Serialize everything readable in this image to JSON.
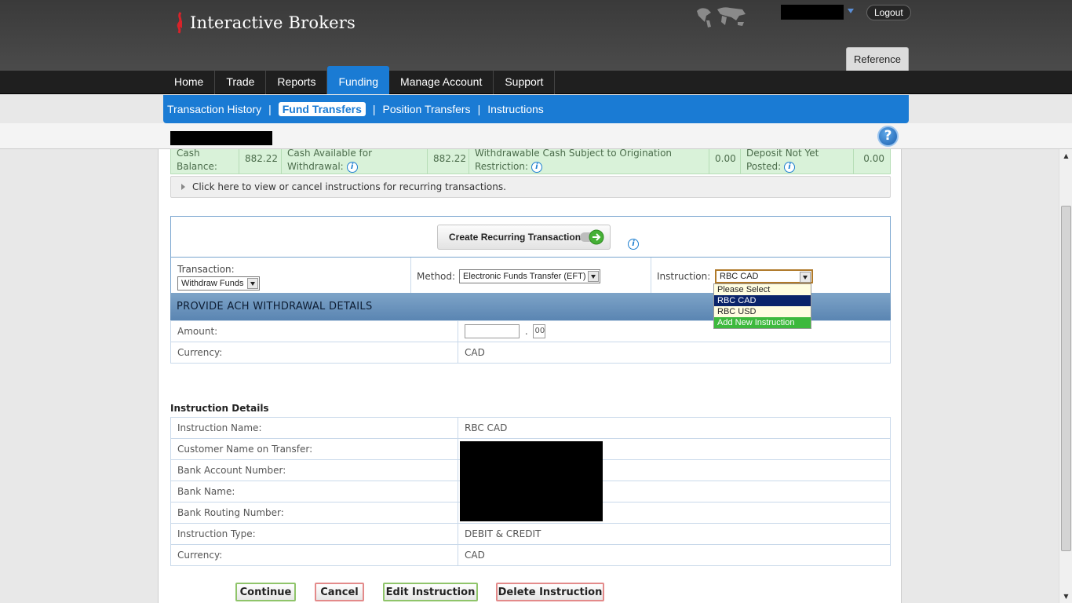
{
  "header": {
    "brand": "Interactive Brokers",
    "logout_label": "Logout",
    "reference_label": "Reference"
  },
  "main_nav": [
    "Home",
    "Trade",
    "Reports",
    "Funding",
    "Manage Account",
    "Support"
  ],
  "main_nav_active": "Funding",
  "sub_nav": {
    "items": [
      "Transaction History",
      "Fund Transfers",
      "Position Transfers",
      "Instructions"
    ],
    "active": "Fund Transfers"
  },
  "balance": {
    "cash_label_1": "Cash",
    "cash_label_2": "Balance:",
    "cash_value": "882.22",
    "avail_label_1": "Cash Available for",
    "avail_label_2": "Withdrawal:",
    "avail_value": "882.22",
    "withdraw_label_1": "Withdrawable Cash Subject to Origination",
    "withdraw_label_2": "Restriction:",
    "withdraw_value": "0.00",
    "deposit_label_1": "Deposit Not Yet",
    "deposit_label_2": "Posted:",
    "deposit_value": "0.00"
  },
  "recurring_link": "Click here to view or cancel instructions for recurring transactions.",
  "create_recurring_label": "Create Recurring Transaction",
  "form": {
    "transaction_label": "Transaction:",
    "transaction_value": "Withdraw Funds",
    "method_label": "Method:",
    "method_value": "Electronic Funds Transfer (EFT)",
    "instruction_label": "Instruction:",
    "instruction_value": "RBC CAD",
    "instruction_options": [
      "Please Select",
      "RBC CAD",
      "RBC USD",
      "Add New Instruction"
    ]
  },
  "withdrawal": {
    "heading": "PROVIDE ACH WITHDRAWAL DETAILS",
    "amount_label": "Amount:",
    "cents_value": "00",
    "currency_label": "Currency:",
    "currency_value": "CAD"
  },
  "instruction_details": {
    "heading": "Instruction Details",
    "rows": [
      {
        "label": "Instruction Name:",
        "value": "RBC CAD"
      },
      {
        "label": "Customer Name on Transfer:",
        "value": ""
      },
      {
        "label": "Bank Account Number:",
        "value": ""
      },
      {
        "label": "Bank Name:",
        "value": ""
      },
      {
        "label": "Bank Routing Number:",
        "value": ""
      },
      {
        "label": "Instruction Type:",
        "value": "DEBIT & CREDIT"
      },
      {
        "label": "Currency:",
        "value": "CAD"
      }
    ]
  },
  "buttons": {
    "continue": "Continue",
    "cancel": "Cancel",
    "edit": "Edit Instruction",
    "delete": "Delete Instruction"
  },
  "colors": {
    "accent_blue": "#1a7bd4",
    "balance_green": "#d9f2d9",
    "add_instruction_green": "#3db93d"
  }
}
